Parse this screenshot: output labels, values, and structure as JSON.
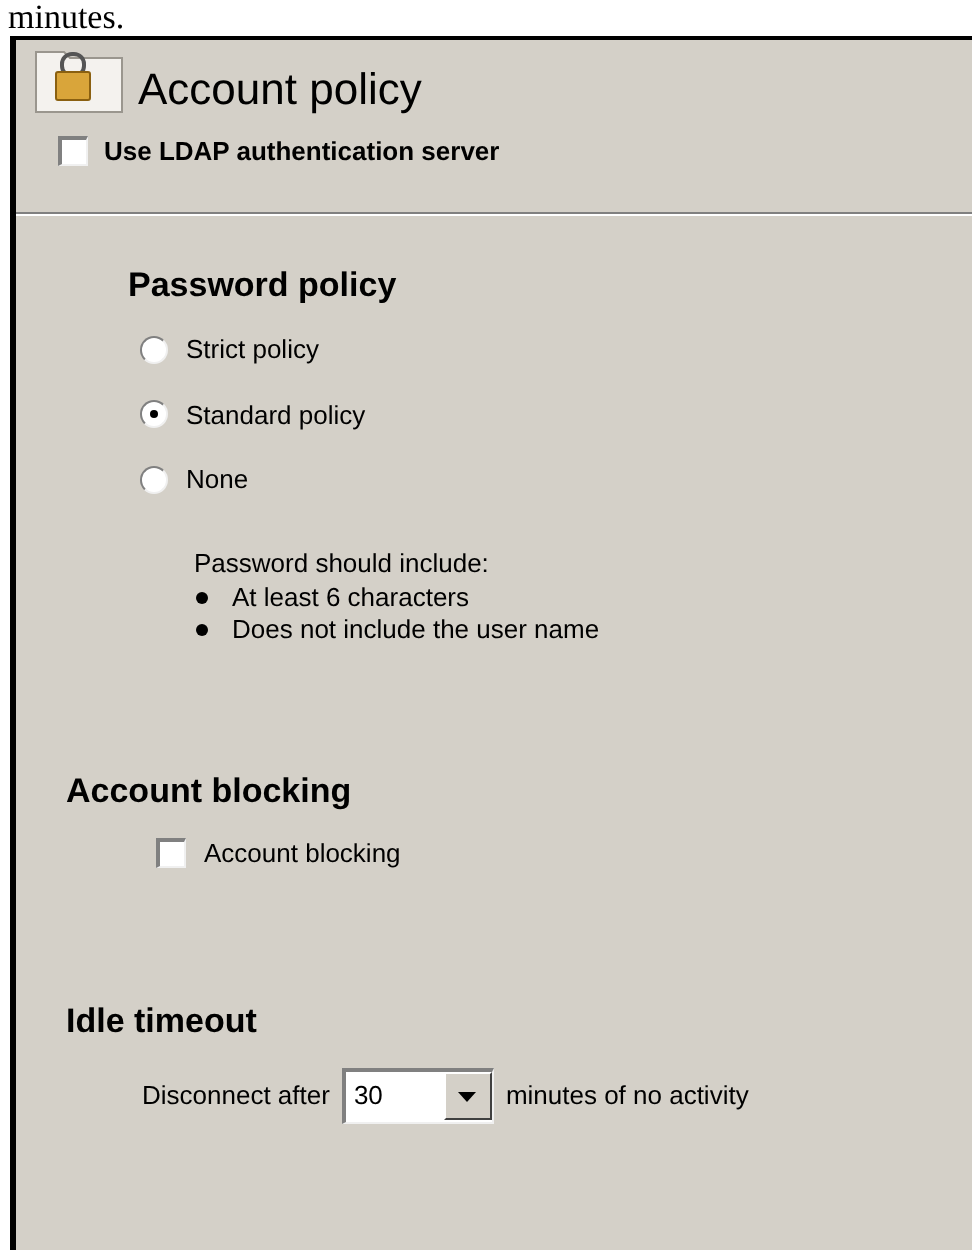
{
  "page_text": "minutes.",
  "panel": {
    "title": "Account policy",
    "ldap": {
      "label": "Use LDAP authentication server",
      "checked": false
    },
    "password_policy": {
      "heading": "Password policy",
      "options": [
        {
          "label": "Strict policy",
          "selected": false
        },
        {
          "label": "Standard policy",
          "selected": true
        },
        {
          "label": "None",
          "selected": false
        }
      ],
      "hint": "Password should include:",
      "rules": [
        "At least 6 characters",
        "Does not include the user name"
      ]
    },
    "account_blocking": {
      "heading": "Account blocking",
      "label": "Account blocking",
      "checked": false
    },
    "idle_timeout": {
      "heading": "Idle timeout",
      "prefix": "Disconnect after",
      "value": "30",
      "suffix": "minutes of no activity"
    }
  }
}
